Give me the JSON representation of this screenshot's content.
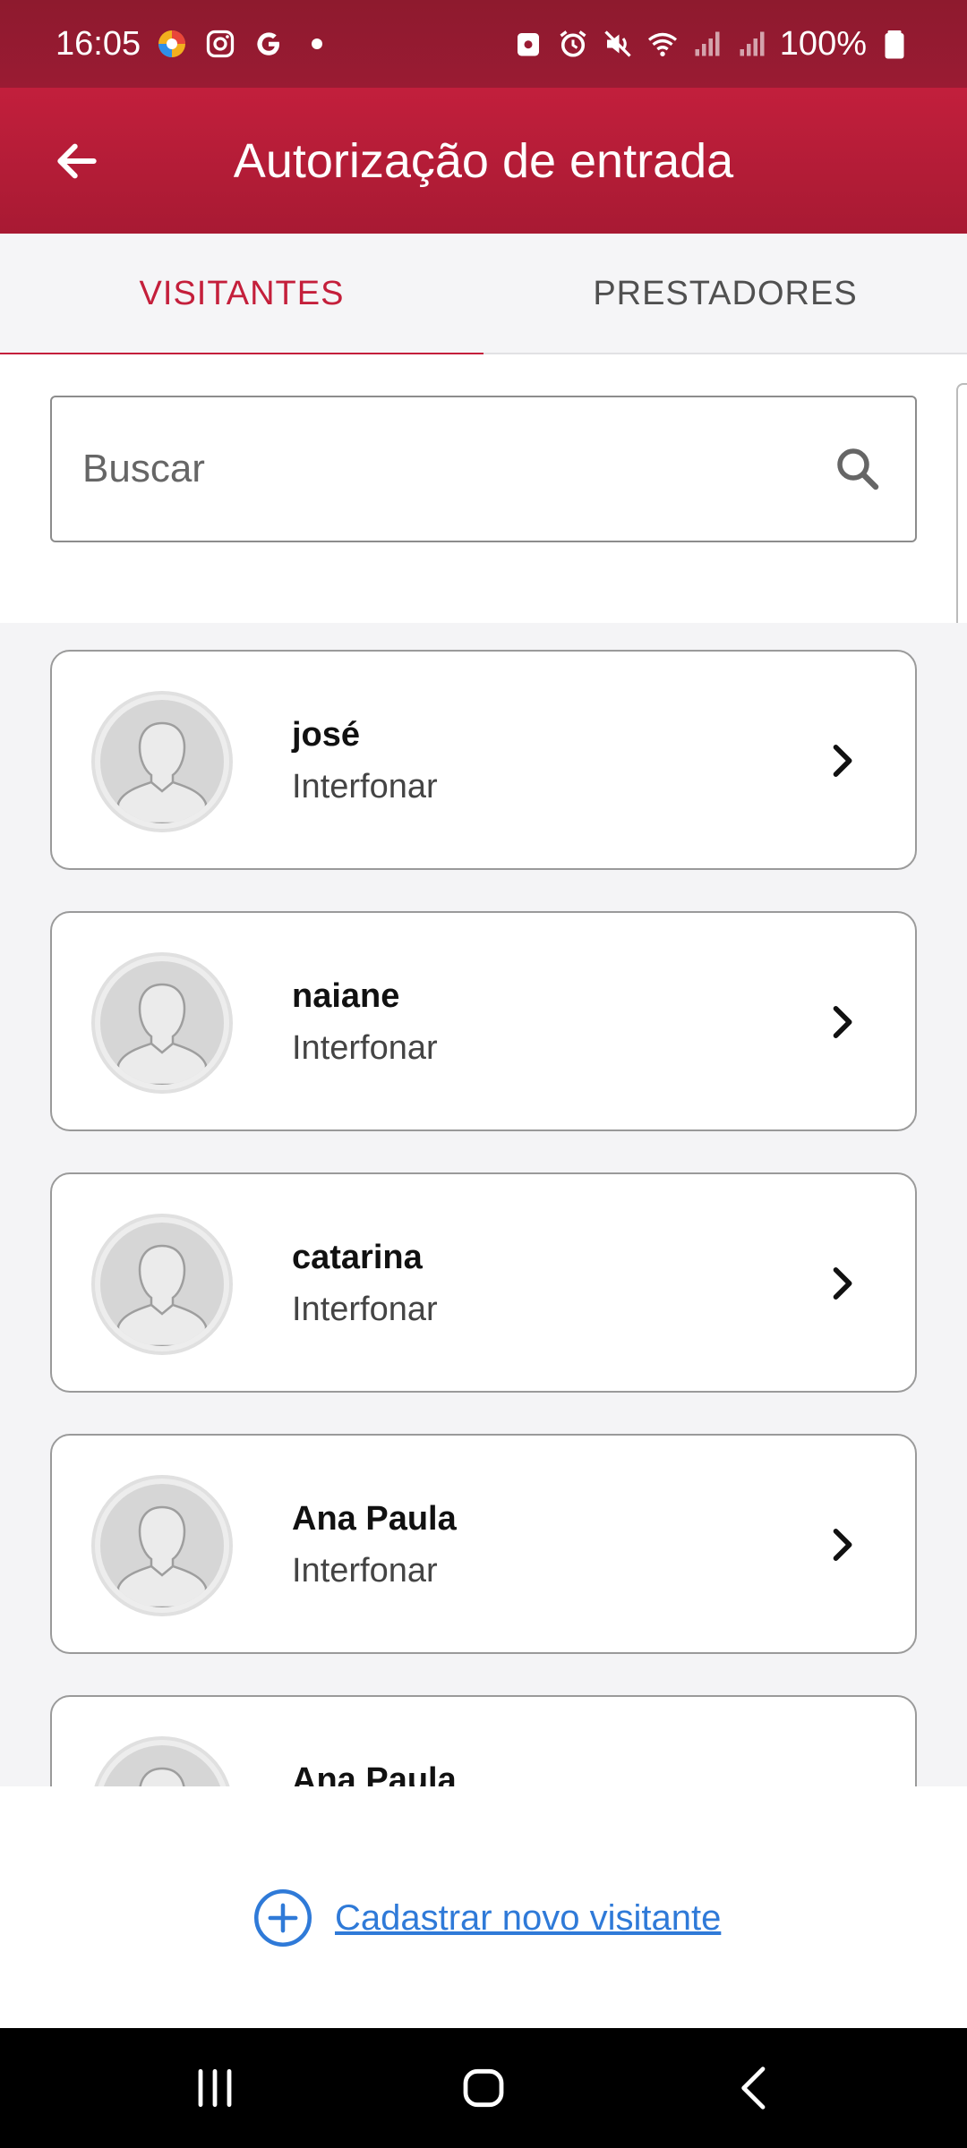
{
  "status_bar": {
    "time": "16:05",
    "battery": "100%",
    "left_icons": [
      "browser-app-icon",
      "instagram-icon",
      "google-icon",
      "dot-icon"
    ],
    "right_icons": [
      "lock-icon",
      "alarm-icon",
      "mute-icon",
      "wifi-icon",
      "signal-icon",
      "signal-icon",
      "battery-icon"
    ]
  },
  "app_bar": {
    "title": "Autorização de entrada"
  },
  "tabs": [
    {
      "label": "VISITANTES",
      "active": true
    },
    {
      "label": "PRESTADORES",
      "active": false
    }
  ],
  "search": {
    "placeholder": "Buscar",
    "value": ""
  },
  "visitors": [
    {
      "name": "josé",
      "subtitle": "Interfonar"
    },
    {
      "name": "naiane",
      "subtitle": "Interfonar"
    },
    {
      "name": "catarina",
      "subtitle": "Interfonar"
    },
    {
      "name": "Ana Paula",
      "subtitle": "Interfonar"
    },
    {
      "name": "Ana Paula",
      "subtitle": ""
    }
  ],
  "footer": {
    "add_label": "Cadastrar novo visitante"
  },
  "colors": {
    "primary": "#c41f3b",
    "status_bar": "#9a1b33",
    "link": "#2f7ad8"
  }
}
